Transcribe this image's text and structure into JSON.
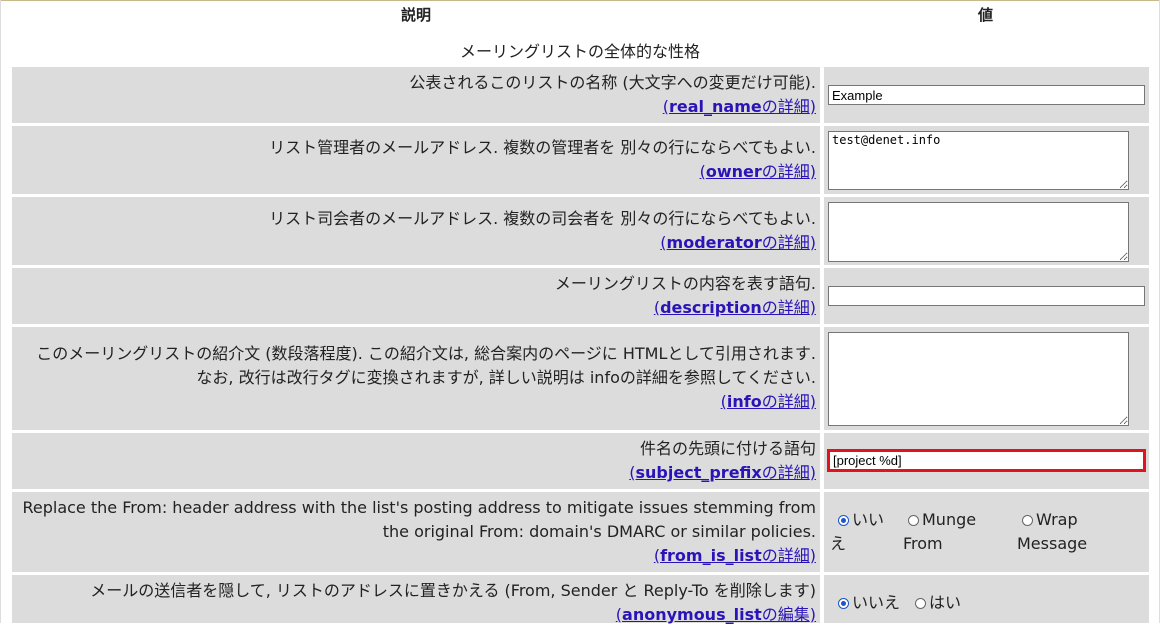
{
  "header": {
    "description": "説明",
    "value": "値"
  },
  "section_title": "メーリングリストの全体的な性格",
  "rows": [
    {
      "line1": "公表されるこのリストの名称 (大文字への変更だけ可能).",
      "param": "real_name",
      "link_suffix": "の詳細",
      "value": "Example"
    },
    {
      "line1": "リスト管理者のメールアドレス. 複数の管理者を 別々の行にならべてもよい.",
      "param": "owner",
      "link_suffix": "の詳細",
      "value": "test@denet.info"
    },
    {
      "line1": "リスト司会者のメールアドレス. 複数の司会者を 別々の行にならべてもよい.",
      "param": "moderator",
      "link_suffix": "の詳細",
      "value": ""
    },
    {
      "line1": "メーリングリストの内容を表す語句.",
      "param": "description",
      "link_suffix": "の詳細",
      "value": ""
    },
    {
      "line1": "このメーリングリストの紹介文 (数段落程度). この紹介文は, 総合案内のページに HTMLとして引用されます.",
      "line2": "なお, 改行は改行タグに変換されますが, 詳しい説明は infoの詳細を参照してください.",
      "param": "info",
      "link_suffix": "の詳細",
      "value": ""
    },
    {
      "line1": "件名の先頭に付ける語句",
      "param": "subject_prefix",
      "link_suffix": "の詳細",
      "value": "[project %d]"
    },
    {
      "line1": "Replace the From: header address with the list's posting address to mitigate issues stemming from",
      "line2": "the original From: domain's DMARC or similar policies.",
      "param": "from_is_list",
      "link_suffix": "の詳細",
      "options": [
        {
          "l1": "いい",
          "l2": "え",
          "selected": true
        },
        {
          "l1": "Munge",
          "l2": "From",
          "selected": false
        },
        {
          "l1": "Wrap",
          "l2": "Message",
          "selected": false
        }
      ]
    },
    {
      "line1": "メールの送信者を隠して, リストのアドレスに置きかえる (From, Sender と Reply-To を削除します)",
      "param": "anonymous_list",
      "link_suffix": "の編集",
      "options": [
        {
          "l1": "いいえ",
          "selected": true
        },
        {
          "l1": "はい",
          "selected": false
        }
      ]
    }
  ]
}
